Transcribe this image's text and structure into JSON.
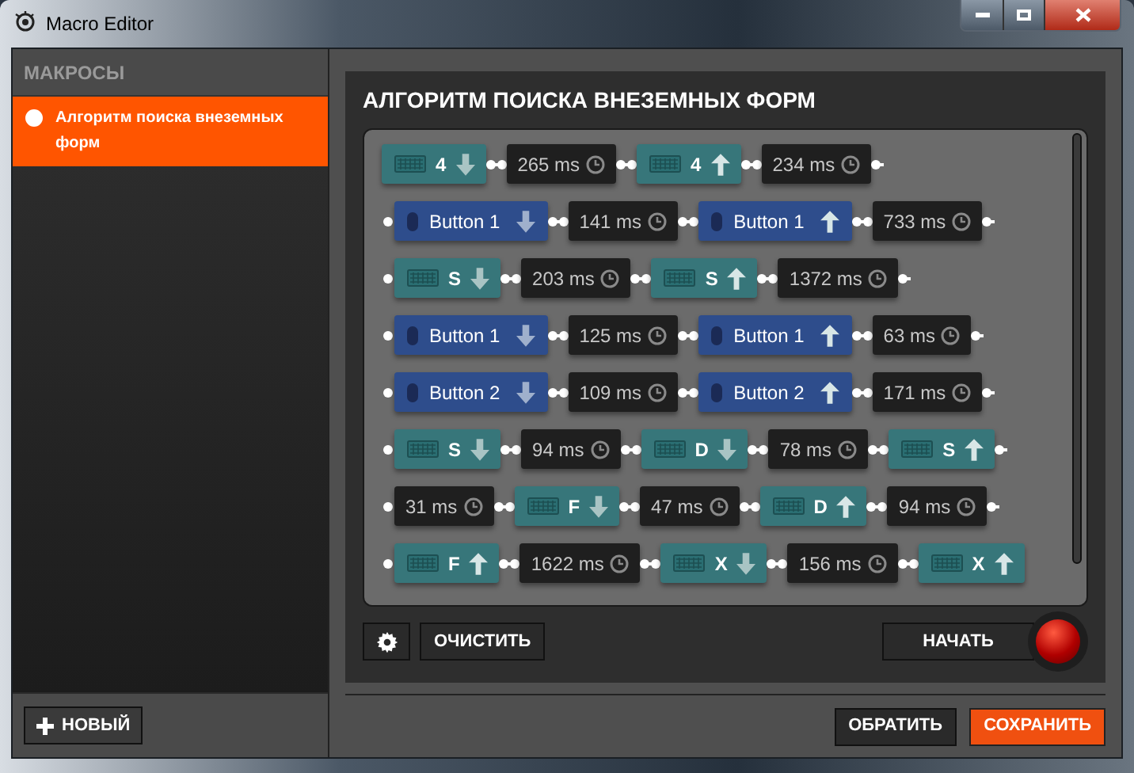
{
  "window": {
    "title": "Macro Editor"
  },
  "sidebar": {
    "header": "МАКРОСЫ",
    "items": [
      {
        "label": "Алгоритм поиска внеземных форм",
        "selected": true
      }
    ],
    "new_button": "НОВЫЙ"
  },
  "editor": {
    "title": "АЛГОРИТМ ПОИСКА ВНЕЗЕМНЫХ ФОРМ",
    "rows": [
      {
        "start_connector": false,
        "end_connector": true,
        "events": [
          {
            "kind": "key",
            "label": "4",
            "pressed": true
          },
          {
            "kind": "delay",
            "label": "265 ms"
          },
          {
            "kind": "key",
            "label": "4",
            "pressed": false
          },
          {
            "kind": "delay",
            "label": "234 ms"
          }
        ]
      },
      {
        "start_connector": true,
        "end_connector": true,
        "events": [
          {
            "kind": "mouse",
            "label": "Button 1",
            "pressed": true
          },
          {
            "kind": "delay",
            "label": "141 ms"
          },
          {
            "kind": "mouse",
            "label": "Button 1",
            "pressed": false
          },
          {
            "kind": "delay",
            "label": "733 ms"
          }
        ]
      },
      {
        "start_connector": true,
        "end_connector": true,
        "events": [
          {
            "kind": "key",
            "label": "S",
            "pressed": true
          },
          {
            "kind": "delay",
            "label": "203 ms"
          },
          {
            "kind": "key",
            "label": "S",
            "pressed": false
          },
          {
            "kind": "delay",
            "label": "1372 ms"
          }
        ]
      },
      {
        "start_connector": true,
        "end_connector": true,
        "events": [
          {
            "kind": "mouse",
            "label": "Button 1",
            "pressed": true
          },
          {
            "kind": "delay",
            "label": "125 ms"
          },
          {
            "kind": "mouse",
            "label": "Button 1",
            "pressed": false
          },
          {
            "kind": "delay",
            "label": "63 ms"
          }
        ]
      },
      {
        "start_connector": true,
        "end_connector": true,
        "events": [
          {
            "kind": "mouse",
            "label": "Button 2",
            "pressed": true
          },
          {
            "kind": "delay",
            "label": "109 ms"
          },
          {
            "kind": "mouse",
            "label": "Button 2",
            "pressed": false
          },
          {
            "kind": "delay",
            "label": "171 ms"
          }
        ]
      },
      {
        "start_connector": true,
        "end_connector": true,
        "events": [
          {
            "kind": "key",
            "label": "S",
            "pressed": true
          },
          {
            "kind": "delay",
            "label": "94 ms"
          },
          {
            "kind": "key",
            "label": "D",
            "pressed": true
          },
          {
            "kind": "delay",
            "label": "78 ms"
          },
          {
            "kind": "key",
            "label": "S",
            "pressed": false
          }
        ]
      },
      {
        "start_connector": true,
        "end_connector": true,
        "events": [
          {
            "kind": "delay",
            "label": "31 ms"
          },
          {
            "kind": "key",
            "label": "F",
            "pressed": true
          },
          {
            "kind": "delay",
            "label": "47 ms"
          },
          {
            "kind": "key",
            "label": "D",
            "pressed": false
          },
          {
            "kind": "delay",
            "label": "94 ms"
          }
        ]
      },
      {
        "start_connector": true,
        "end_connector": false,
        "events": [
          {
            "kind": "key",
            "label": "F",
            "pressed": false
          },
          {
            "kind": "delay",
            "label": "1622 ms"
          },
          {
            "kind": "key",
            "label": "X",
            "pressed": true
          },
          {
            "kind": "delay",
            "label": "156 ms"
          },
          {
            "kind": "key",
            "label": "X",
            "pressed": false
          }
        ]
      }
    ],
    "clear_button": "ОЧИСТИТЬ",
    "start_button": "НАЧАТЬ"
  },
  "footer": {
    "buttons": [
      {
        "label": "ОБРАТИТЬ",
        "kind": "secondary"
      },
      {
        "label": "СОХРАНИТЬ",
        "kind": "primary"
      }
    ]
  }
}
